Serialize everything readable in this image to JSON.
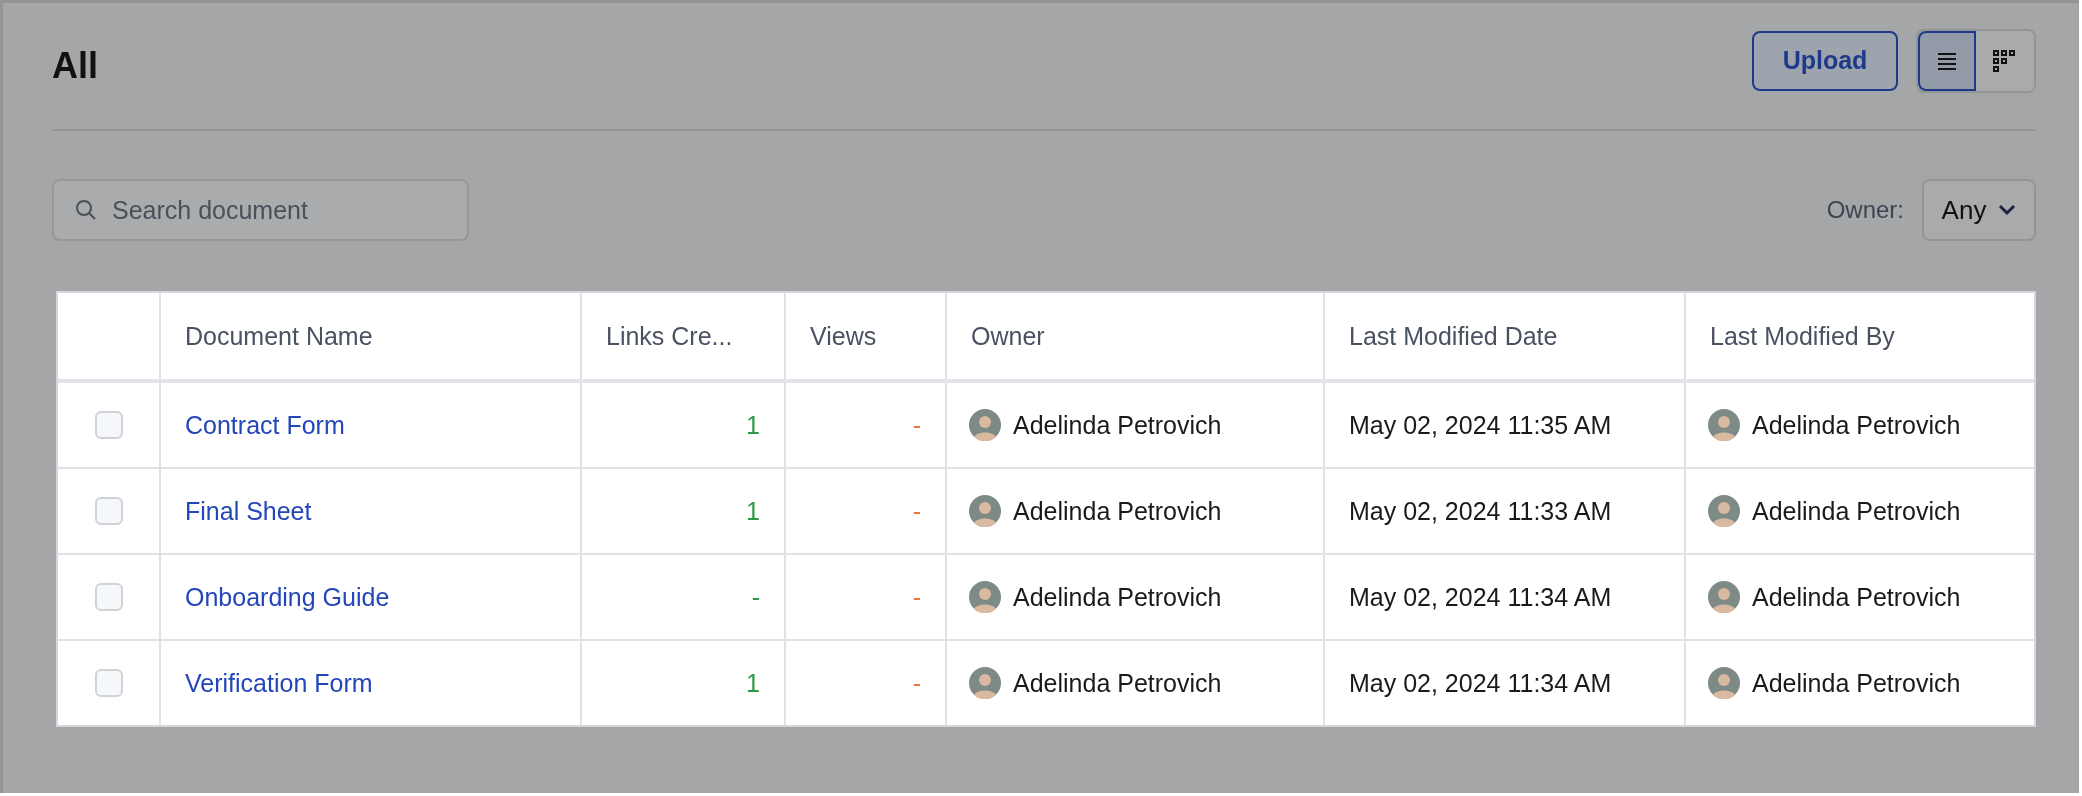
{
  "title": "All",
  "upload_button": "Upload",
  "view_toggle": [
    {
      "kind": "list",
      "selected": true
    },
    {
      "kind": "grid",
      "selected": false
    }
  ],
  "search": {
    "placeholder": "Search document"
  },
  "owner_filter": {
    "label": "Owner:",
    "value": "Any"
  },
  "table": {
    "columns": [
      "Document Name",
      "Links Cre...",
      "Views",
      "Owner",
      "Last Modified Date",
      "Last Modified By"
    ],
    "rows": [
      {
        "checked": false,
        "name": "Contract Form",
        "links": "1",
        "views": "-",
        "owner": "Adelinda Petrovich",
        "modified_date": "May 02, 2024 11:35 AM",
        "modified_by": "Adelinda Petrovich"
      },
      {
        "checked": false,
        "name": "Final Sheet",
        "links": "1",
        "views": "-",
        "owner": "Adelinda Petrovich",
        "modified_date": "May 02, 2024 11:33 AM",
        "modified_by": "Adelinda Petrovich"
      },
      {
        "checked": false,
        "name": "Onboarding Guide",
        "links": "-",
        "views": "-",
        "owner": "Adelinda Petrovich",
        "modified_date": "May 02, 2024 11:34 AM",
        "modified_by": "Adelinda Petrovich"
      },
      {
        "checked": false,
        "name": "Verification Form",
        "links": "1",
        "views": "-",
        "owner": "Adelinda Petrovich",
        "modified_date": "May 02, 2024 11:34 AM",
        "modified_by": "Adelinda Petrovich"
      }
    ]
  }
}
